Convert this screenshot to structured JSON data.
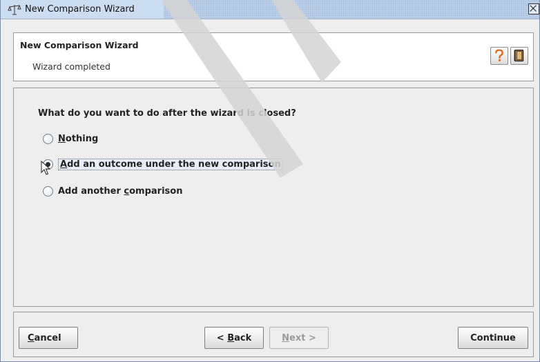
{
  "window": {
    "title": "New Comparison Wizard"
  },
  "header": {
    "title": "New Comparison Wizard",
    "subtitle": "Wizard completed",
    "help_icon": "question-mark-icon",
    "book_icon": "book-icon"
  },
  "main": {
    "question": "What do you want to do after the wizard is closed?",
    "options": [
      {
        "pre": "",
        "mnemonic": "N",
        "post": "othing",
        "checked": false
      },
      {
        "pre": "",
        "mnemonic": "A",
        "post": "dd an outcome under the new comparison",
        "checked": true
      },
      {
        "pre": "Add another ",
        "mnemonic": "c",
        "post": "omparison",
        "checked": false
      }
    ]
  },
  "buttons": {
    "cancel": {
      "mnemonic": "C",
      "rest": "ancel"
    },
    "back": {
      "pre": "< ",
      "mnemonic": "B",
      "rest": "ack"
    },
    "next": {
      "mnemonic": "N",
      "rest": "ext >",
      "disabled": true
    },
    "continue": "Continue"
  },
  "colors": {
    "titlebar": "#bcd0ea",
    "panel": "#eeeeee",
    "help_accent": "#e06a1e"
  }
}
